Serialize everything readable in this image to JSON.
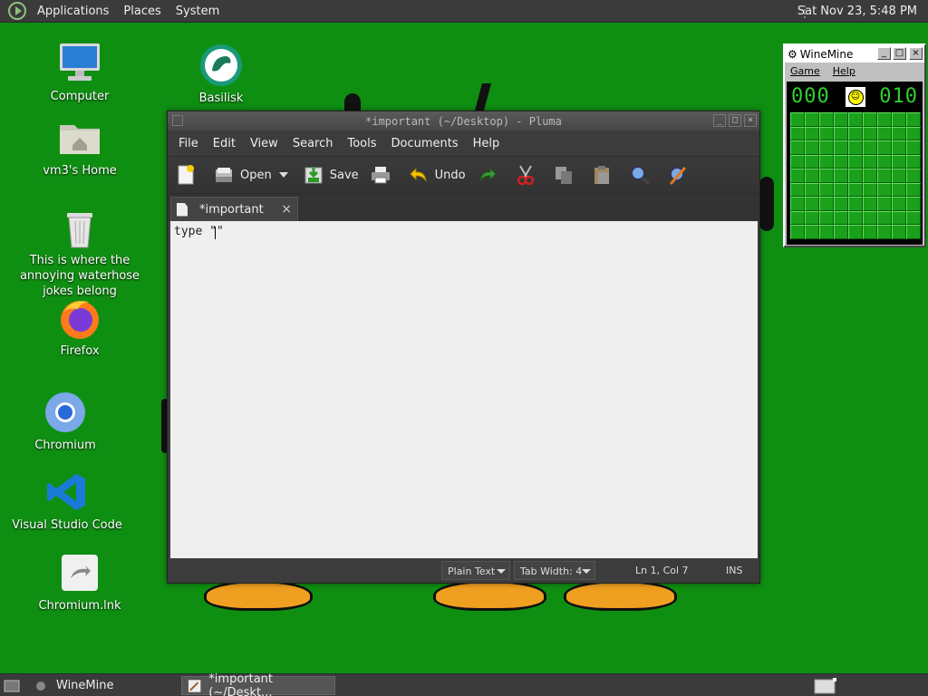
{
  "top_panel": {
    "menus": [
      "Applications",
      "Places",
      "System"
    ],
    "clock": "Sat Nov 23,  5:48 PM"
  },
  "desktop_icons": [
    {
      "label": "Computer",
      "icon": "computer-icon"
    },
    {
      "label": "Basilisk",
      "icon": "basilisk-icon"
    },
    {
      "label": "vm3's Home",
      "icon": "home-folder-icon"
    },
    {
      "label": "This is where the annoying waterhose jokes belong",
      "icon": "trash-icon"
    },
    {
      "label": "Firefox",
      "icon": "firefox-icon"
    },
    {
      "label": "Chromium",
      "icon": "chromium-icon"
    },
    {
      "label": "Visual Studio Code",
      "icon": "vscode-icon"
    },
    {
      "label": "Chromium.lnk",
      "icon": "shortcut-icon"
    }
  ],
  "pluma": {
    "title": "*important (~/Desktop) - Pluma",
    "menu": [
      "File",
      "Edit",
      "View",
      "Search",
      "Tools",
      "Documents",
      "Help"
    ],
    "toolbar": {
      "open_label": "Open",
      "save_label": "Save",
      "undo_label": "Undo"
    },
    "tab_label": "*important",
    "tab_close": "×",
    "editor_text": "type \"\"",
    "status": {
      "language": "Plain Text",
      "tab_width": "Tab Width:  4",
      "position": "Ln 1, Col 7",
      "mode": "INS"
    }
  },
  "winemine": {
    "title": "WineMine",
    "menu": [
      "Game",
      "Help"
    ],
    "mines_counter": "000",
    "timer": "010",
    "grid_rows": 9,
    "grid_cols": 9
  },
  "taskbar": {
    "items": [
      "WineMine",
      "*important (~/Deskt..."
    ]
  },
  "colors": {
    "desktop": "#0f8f12",
    "panel": "#3b3b3b",
    "counter": "#30d030"
  }
}
